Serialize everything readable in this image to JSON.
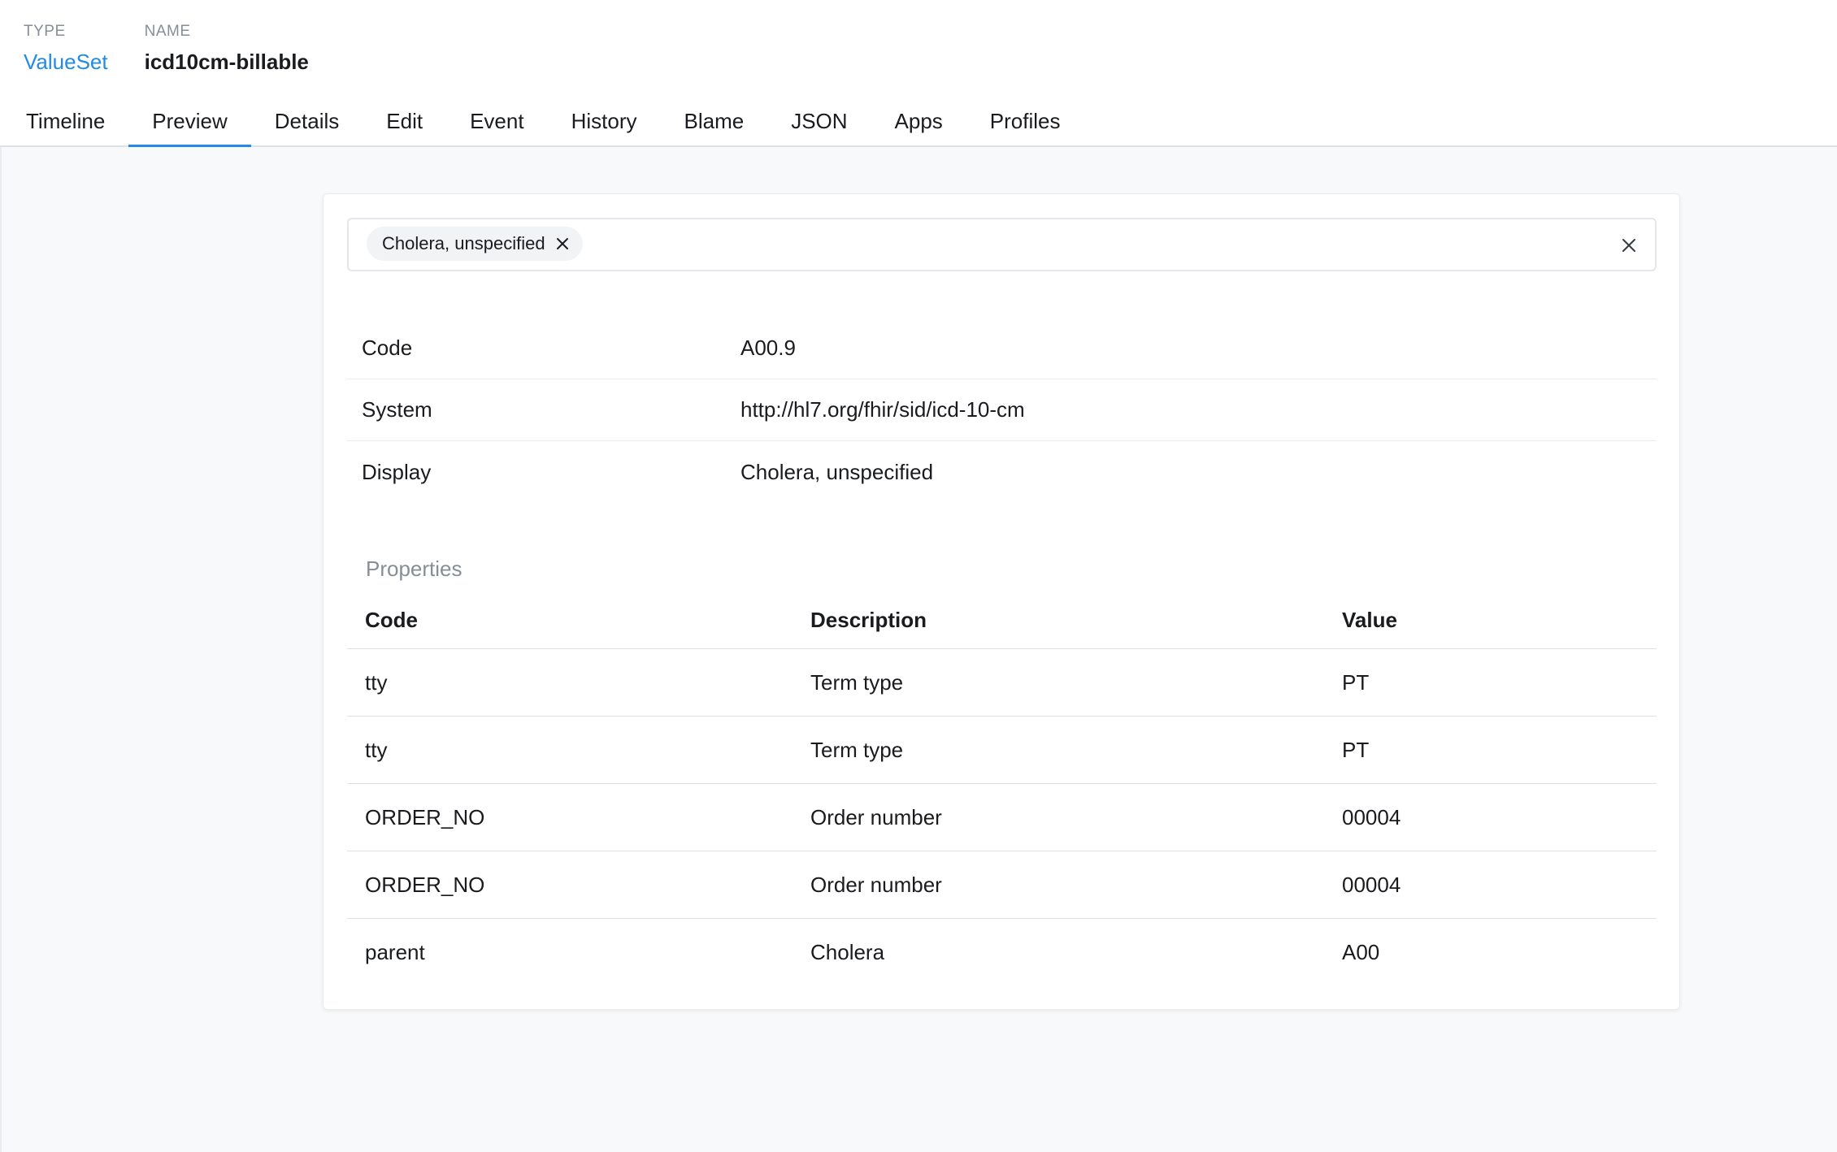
{
  "header": {
    "type_label": "TYPE",
    "type_value": "ValueSet",
    "name_label": "NAME",
    "name_value": "icd10cm-billable"
  },
  "tabs": [
    {
      "label": "Timeline",
      "active": false
    },
    {
      "label": "Preview",
      "active": true
    },
    {
      "label": "Details",
      "active": false
    },
    {
      "label": "Edit",
      "active": false
    },
    {
      "label": "Event",
      "active": false
    },
    {
      "label": "History",
      "active": false
    },
    {
      "label": "Blame",
      "active": false
    },
    {
      "label": "JSON",
      "active": false
    },
    {
      "label": "Apps",
      "active": false
    },
    {
      "label": "Profiles",
      "active": false
    }
  ],
  "search": {
    "selected_pill": "Cholera, unspecified"
  },
  "concept": {
    "rows": [
      {
        "key": "Code",
        "value": "A00.9"
      },
      {
        "key": "System",
        "value": "http://hl7.org/fhir/sid/icd-10-cm"
      },
      {
        "key": "Display",
        "value": "Cholera, unspecified"
      }
    ]
  },
  "properties": {
    "caption": "Properties",
    "headers": [
      "Code",
      "Description",
      "Value"
    ],
    "rows": [
      [
        "tty",
        "Term type",
        "PT"
      ],
      [
        "tty",
        "Term type",
        "PT"
      ],
      [
        "ORDER_NO",
        "Order number",
        "00004"
      ],
      [
        "ORDER_NO",
        "Order number",
        "00004"
      ],
      [
        "parent",
        "Cholera",
        "A00"
      ]
    ]
  },
  "colors": {
    "accent": "#228be6",
    "muted": "#868e96",
    "background": "#f8f9fa"
  }
}
